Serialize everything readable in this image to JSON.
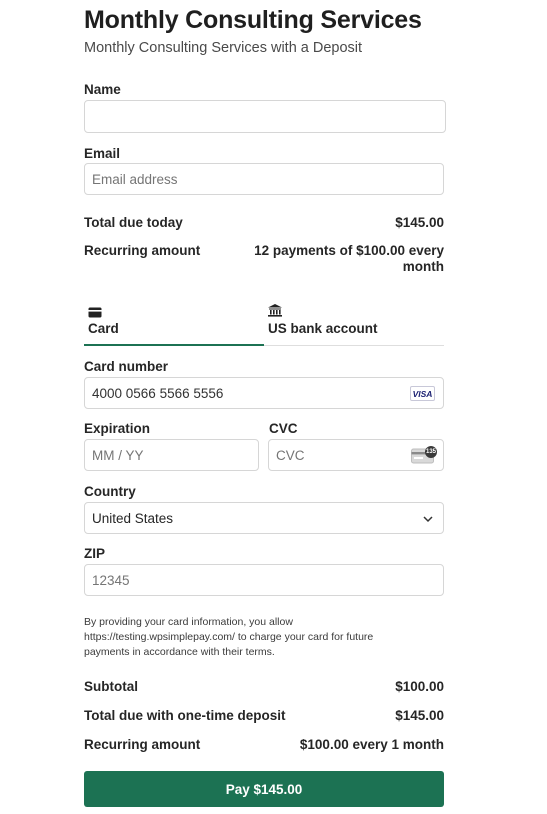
{
  "header": {
    "title": "Monthly Consulting Services",
    "subtitle": "Monthly Consulting Services with a Deposit"
  },
  "fields": {
    "name_label": "Name",
    "name_value": "",
    "email_label": "Email",
    "email_placeholder": "Email address"
  },
  "summary_top": {
    "total_today_label": "Total due today",
    "total_today_value": "$145.00",
    "recurring_label": "Recurring amount",
    "recurring_value": "12 payments of $100.00 every month"
  },
  "tabs": [
    {
      "label": "Card",
      "icon": "credit-card-icon",
      "selected": true
    },
    {
      "label": "US bank account",
      "icon": "bank-icon",
      "selected": false
    }
  ],
  "card": {
    "number_label": "Card number",
    "number_value": "4000 0566 5566 5556",
    "brand": "VISA",
    "expiration_label": "Expiration",
    "expiration_placeholder": "MM / YY",
    "cvc_label": "CVC",
    "cvc_placeholder": "CVC",
    "cvc_badge": "135",
    "country_label": "Country",
    "country_value": "United States",
    "zip_label": "ZIP",
    "zip_placeholder": "12345"
  },
  "disclaimer": "By providing your card information, you allow https://testing.wpsimplepay.com/ to charge your card for future payments in accordance with their terms.",
  "summary_bottom": {
    "subtotal_label": "Subtotal",
    "subtotal_value": "$100.00",
    "deposit_label": "Total due with one-time deposit",
    "deposit_value": "$145.00",
    "recurring_label": "Recurring amount",
    "recurring_value": "$100.00 every 1 month"
  },
  "pay_button_label": "Pay $145.00",
  "colors": {
    "accent": "#1c7253",
    "border": "#d6d6d6",
    "text": "#262626"
  }
}
